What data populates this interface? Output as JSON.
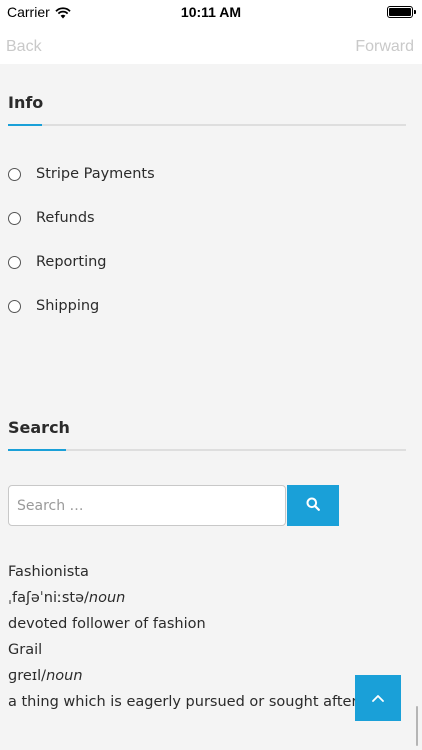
{
  "status_bar": {
    "carrier": "Carrier",
    "time": "10:11 AM",
    "battery_level": 1.0
  },
  "nav": {
    "back_label": "Back",
    "forward_label": "Forward"
  },
  "info": {
    "title": "Info",
    "items": [
      {
        "label": "Stripe Payments"
      },
      {
        "label": "Refunds"
      },
      {
        "label": "Reporting"
      },
      {
        "label": "Shipping"
      }
    ]
  },
  "search": {
    "title": "Search",
    "placeholder": "Search …",
    "button_icon": "search-icon"
  },
  "glossary": {
    "entries": [
      {
        "word": "Fashionista",
        "phonetic": "ˌfaʃəˈniːstə/",
        "pos": "noun",
        "definition": " devoted follower of fashion"
      },
      {
        "word": "Grail",
        "phonetic": "ɡreɪl/",
        "pos": "noun",
        "definition": "a thing which is eagerly pursued or sought after."
      }
    ]
  },
  "scroll_top": {
    "icon": "chevron-up-icon"
  },
  "colors": {
    "accent": "#1aa0d8",
    "background": "#f4f4f4",
    "nav_disabled": "#c9c9c9"
  }
}
